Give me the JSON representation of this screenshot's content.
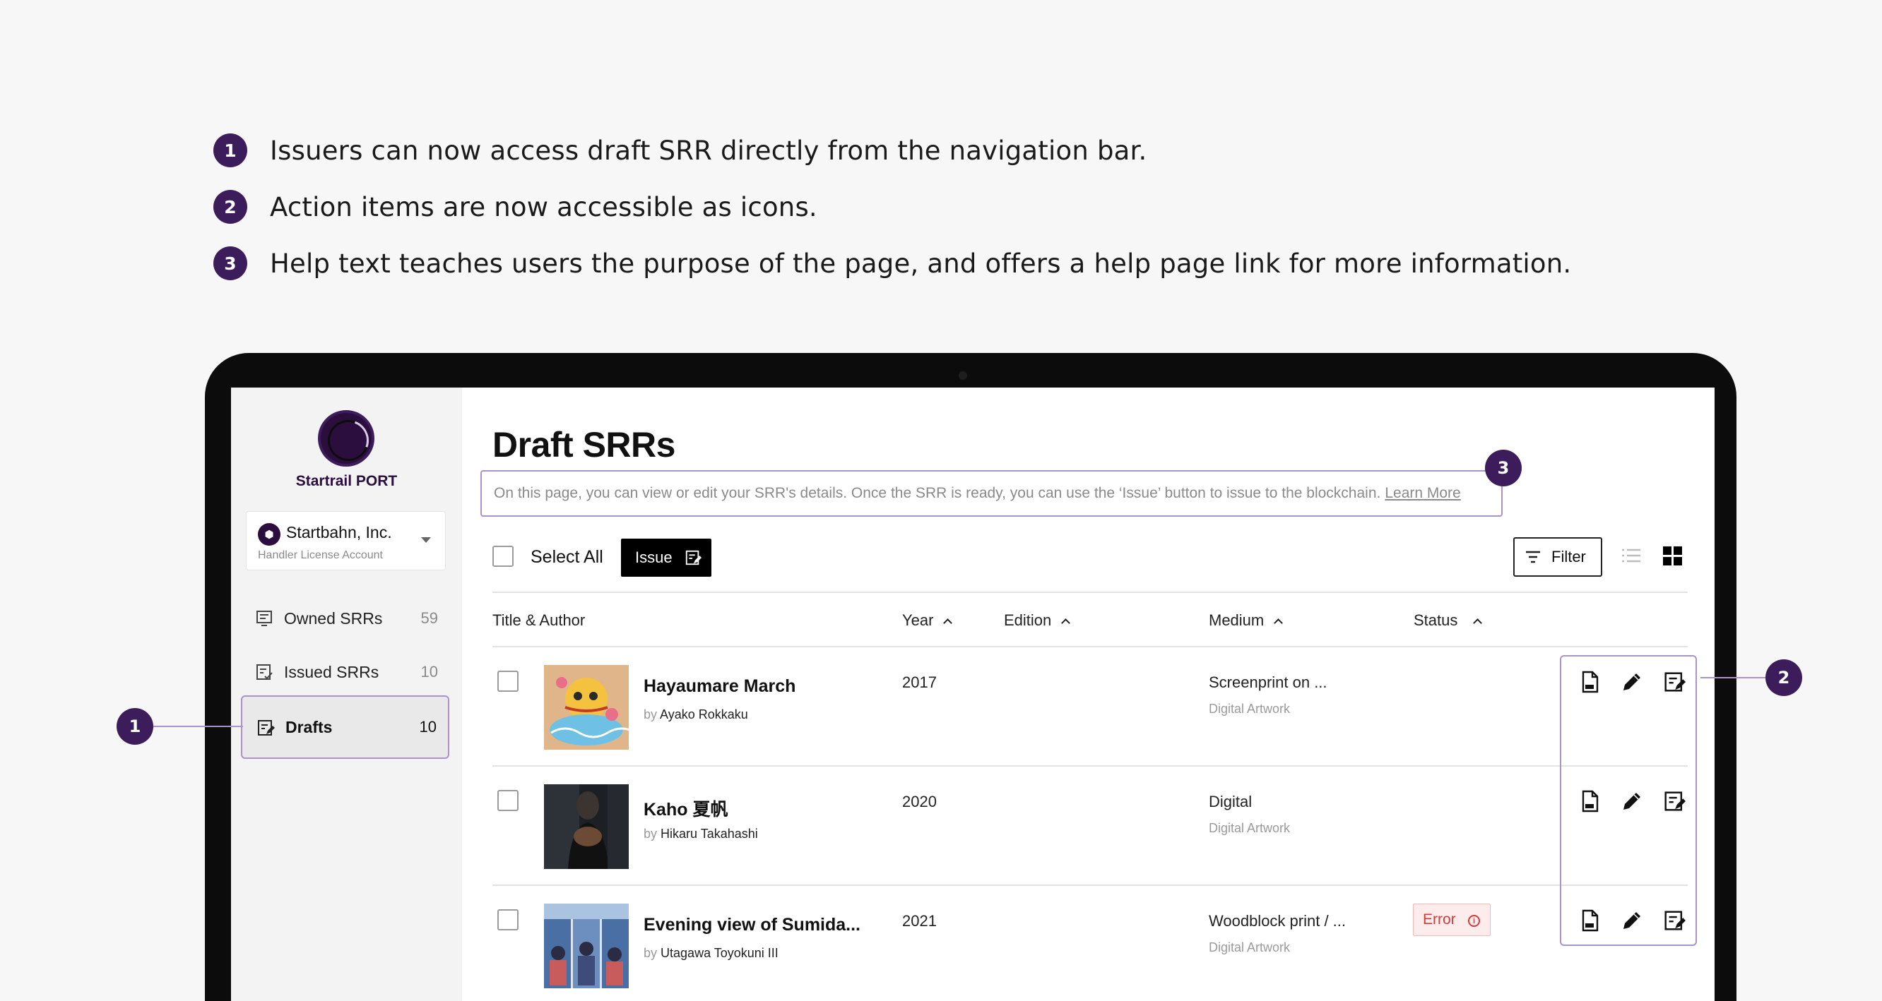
{
  "notes": [
    {
      "num": "1",
      "text": "Issuers can now access draft SRR directly from the navigation bar."
    },
    {
      "num": "2",
      "text": "Action items are now accessible as icons."
    },
    {
      "num": "3",
      "text": "Help text teaches users the purpose of the page, and offers a help page link for more information."
    }
  ],
  "callouts": {
    "nav": "1",
    "actions": "2",
    "help": "3"
  },
  "brand": {
    "name": "Startrail PORT",
    "logo_mark": "Startrail"
  },
  "account": {
    "name": "Startbahn, Inc.",
    "type": "Handler License Account",
    "icon": "cube-icon"
  },
  "sidebar": {
    "items": [
      {
        "label": "Owned SRRs",
        "count": "59",
        "icon": "owned-srr-icon"
      },
      {
        "label": "Issued SRRs",
        "count": "10",
        "icon": "issued-srr-icon"
      },
      {
        "label": "Drafts",
        "count": "10",
        "icon": "drafts-icon",
        "active": true
      }
    ]
  },
  "main": {
    "title": "Draft SRRs",
    "help_text": "On this page, you can view or edit your SRR's details. Once the SRR is ready, you can use the ‘Issue’ button to issue to the blockchain.",
    "help_link": "Learn More",
    "select_all": "Select All",
    "issue_label": "Issue",
    "filter_label": "Filter"
  },
  "table": {
    "headers": {
      "title": "Title & Author",
      "year": "Year",
      "edition": "Edition",
      "medium": "Medium",
      "status": "Status"
    },
    "rows": [
      {
        "title": "Hayaumare March",
        "by": "by",
        "author": "Ayako Rokkaku",
        "year": "2017",
        "medium": "Screenprint on ...",
        "medium_sub": "Digital Artwork",
        "status": ""
      },
      {
        "title": "Kaho 夏帆",
        "by": "by",
        "author": "Hikaru Takahashi",
        "year": "2020",
        "medium": "Digital",
        "medium_sub": "Digital Artwork",
        "status": ""
      },
      {
        "title": "Evening view of Sumida...",
        "by": "by",
        "author": "Utagawa Toyokuni III",
        "year": "2021",
        "medium": "Woodblock print / ...",
        "medium_sub": "Digital Artwork",
        "status": "Error"
      }
    ]
  },
  "colors": {
    "accent": "#3d1c5b",
    "highlight": "#a993c9",
    "error": "#d43c3c"
  }
}
